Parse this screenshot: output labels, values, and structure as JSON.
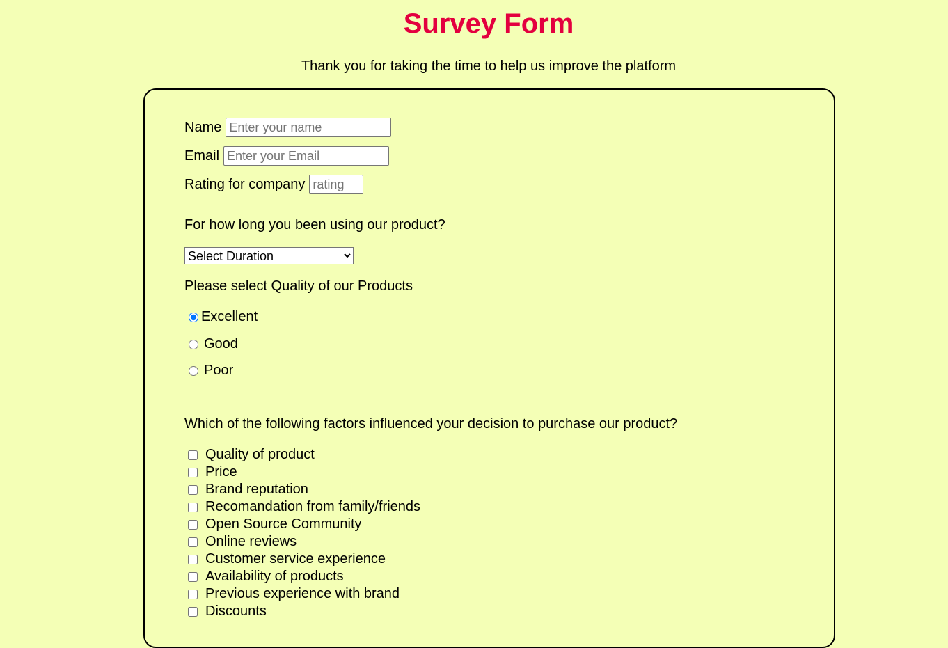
{
  "header": {
    "title": "Survey Form",
    "subtitle": "Thank you for taking the time to help us improve the platform"
  },
  "form": {
    "name": {
      "label": "Name",
      "placeholder": "Enter your name"
    },
    "email": {
      "label": "Email",
      "placeholder": "Enter your Email"
    },
    "rating": {
      "label": "Rating for company",
      "placeholder": "rating"
    },
    "duration": {
      "question": "For how long you been using our product?",
      "selected": "Select Duration"
    },
    "quality": {
      "question": "Please select Quality of our Products",
      "options": [
        "Excellent",
        "Good",
        "Poor"
      ],
      "selected": "Excellent"
    },
    "factors": {
      "question": "Which of the following factors influenced your decision to purchase our product?",
      "options": [
        "Quality of product",
        "Price",
        "Brand reputation",
        "Recomandation from family/friends",
        "Open Source Community",
        "Online reviews",
        "Customer service experience",
        "Availability of products",
        "Previous experience with brand",
        "Discounts"
      ]
    }
  }
}
